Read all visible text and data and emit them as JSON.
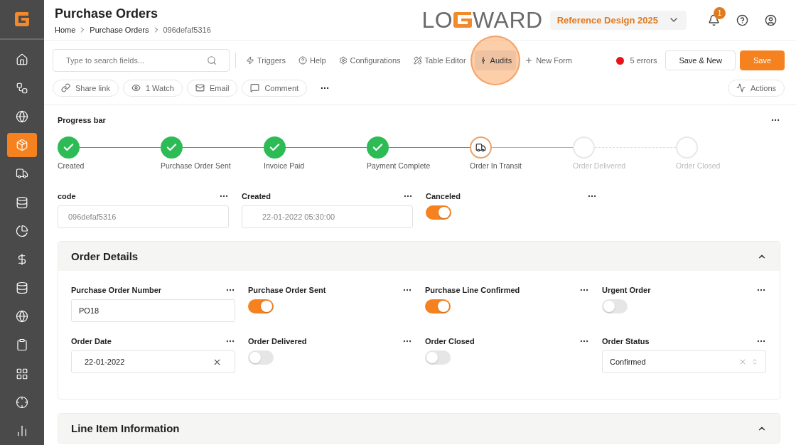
{
  "sidebar": {
    "items": [
      {
        "selected": false
      },
      {
        "selected": false
      },
      {
        "selected": false
      },
      {
        "selected": true
      },
      {
        "selected": false
      },
      {
        "selected": false
      },
      {
        "selected": false
      },
      {
        "selected": false
      },
      {
        "selected": false
      },
      {
        "selected": false
      },
      {
        "selected": false
      },
      {
        "selected": false
      },
      {
        "selected": false
      },
      {
        "selected": false
      }
    ]
  },
  "header": {
    "title": "Purchase Orders",
    "breadcrumb": [
      "Home",
      "Purchase Orders",
      "096defaf5316"
    ],
    "logo": {
      "left": "LO",
      "right": "WARD"
    },
    "workspace": "Reference Design 2025",
    "notification_count": "1"
  },
  "toolbar": {
    "search_placeholder": "Type to search fields...",
    "items": [
      {
        "label": "Triggers",
        "selected": false,
        "highlighted": false
      },
      {
        "label": "Help",
        "selected": false,
        "highlighted": false
      },
      {
        "label": "Configurations",
        "selected": false,
        "highlighted": false
      },
      {
        "label": "Table Editor",
        "selected": false,
        "highlighted": false
      },
      {
        "label": "Audits",
        "selected": true,
        "highlighted": true
      },
      {
        "label": "New Form",
        "selected": false,
        "highlighted": false
      }
    ],
    "errors": "5 errors",
    "buttons": [
      {
        "kind": "outline",
        "label": "Save & New"
      },
      {
        "kind": "primary",
        "label": "Save"
      }
    ],
    "pills": [
      {
        "label": "Share link"
      },
      {
        "label": "1 Watch"
      },
      {
        "label": "Email"
      },
      {
        "label": "Comment"
      }
    ],
    "actions": "Actions"
  },
  "progress": {
    "title": "Progress bar",
    "steps": [
      {
        "label": "Created",
        "completed": true,
        "active": false
      },
      {
        "label": "Purchase Order Sent",
        "completed": true,
        "active": false
      },
      {
        "label": "Invoice Paid",
        "completed": true,
        "active": false
      },
      {
        "label": "Payment Complete",
        "completed": true,
        "active": false
      },
      {
        "label": "Order In Transit",
        "completed": false,
        "active": true
      },
      {
        "label": "Order Delivered",
        "completed": false,
        "active": false
      },
      {
        "label": "Order Closed",
        "completed": false,
        "active": false
      }
    ],
    "fields": [
      {
        "kind": "readonly",
        "label": "code",
        "value": "096defaf5316"
      },
      {
        "kind": "readonly",
        "label": "Created",
        "value": "22-01-2022 05:30:00"
      },
      {
        "kind": "toggle",
        "label": "Canceled",
        "on": true
      }
    ]
  },
  "sections": [
    {
      "title": "Order Details",
      "expanded": true,
      "fields": [
        {
          "kind": "text",
          "label": "Purchase Order Number",
          "value": "PO18"
        },
        {
          "kind": "toggle",
          "label": "Purchase Order Sent",
          "on": true
        },
        {
          "kind": "toggle",
          "label": "Purchase Line Confirmed",
          "on": true
        },
        {
          "kind": "toggle",
          "label": "Urgent Order",
          "on": false
        },
        {
          "kind": "date",
          "label": "Order Date",
          "value": "22-01-2022"
        },
        {
          "kind": "toggle",
          "label": "Order Delivered",
          "on": false
        },
        {
          "kind": "toggle",
          "label": "Order Closed",
          "on": false
        },
        {
          "kind": "select",
          "label": "Order Status",
          "value": "Confirmed"
        }
      ]
    },
    {
      "title": "Line Item Information",
      "expanded": true
    }
  ]
}
